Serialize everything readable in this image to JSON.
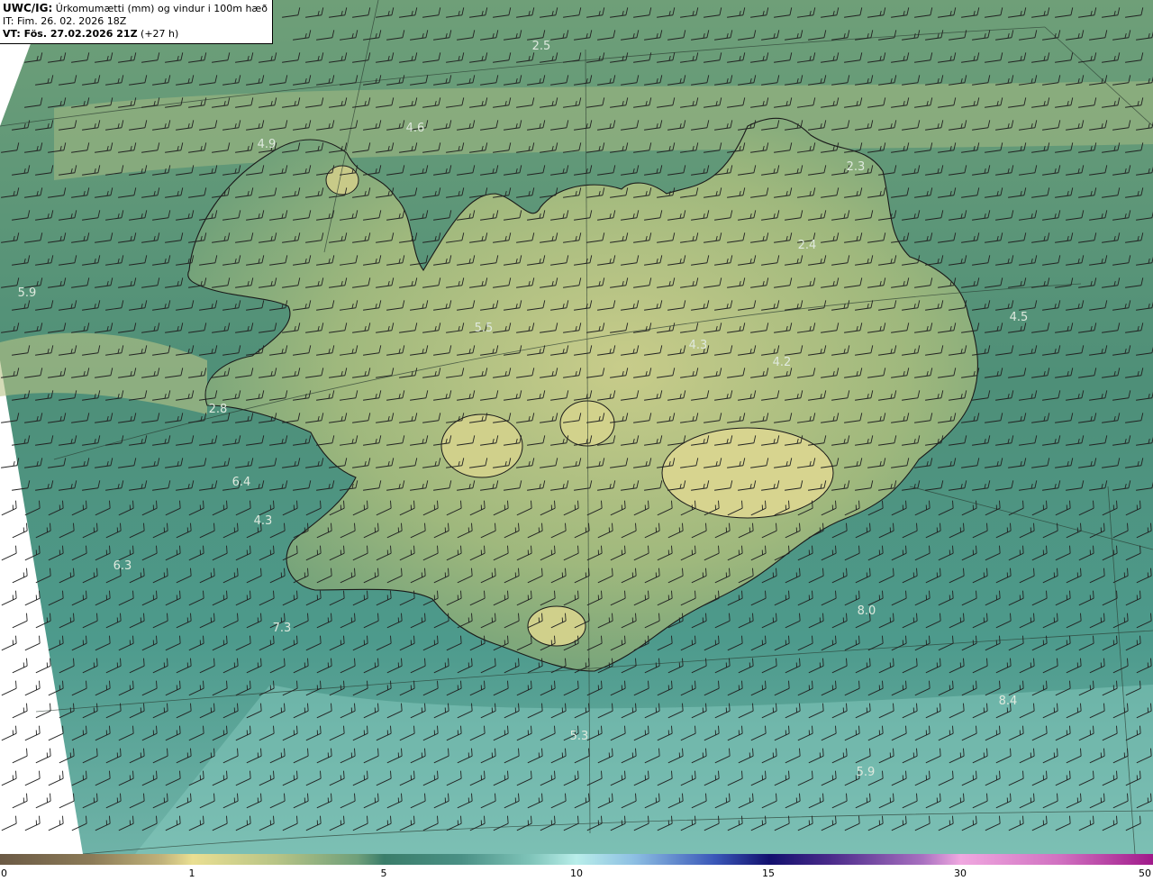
{
  "header": {
    "model_code": "UWC/IG:",
    "title": " Úrkomumætti (mm) og vindur i 100m hæð",
    "init_time": "IT: Fim. 26. 02. 2026 18Z",
    "valid_prefix": "VT: ",
    "valid_time": "Fös. 27.02.2026 21Z",
    "lead_time": " (+27 h)"
  },
  "colorbar": {
    "ticks": [
      "0",
      "1",
      "5",
      "10",
      "15",
      "30",
      "50"
    ],
    "colors": [
      "#6b5a45",
      "#eadf92",
      "#3a7d6a",
      "#b9eeea",
      "#12106e",
      "#f0a8e0",
      "#a01a8a"
    ]
  },
  "map": {
    "colors": {
      "ocean_north": "#5f9b76",
      "ocean_south": "#3f8d7d",
      "land": "#a9bc7f",
      "land_high": "#d4d28e",
      "coast": "#1a1a1a",
      "barb": "#222222",
      "value_label": "#dfe9de"
    },
    "labels": [
      {
        "text": "2.5"
      },
      {
        "text": "4.6"
      },
      {
        "text": "4.9"
      },
      {
        "text": "2.3"
      },
      {
        "text": "2.4"
      },
      {
        "text": "5.9"
      },
      {
        "text": "5.5"
      },
      {
        "text": "4.5"
      },
      {
        "text": "4.3"
      },
      {
        "text": "4.2"
      },
      {
        "text": "2.8"
      },
      {
        "text": "6.4"
      },
      {
        "text": "4.3"
      },
      {
        "text": "6.3"
      },
      {
        "text": "7.3"
      },
      {
        "text": "8.0"
      },
      {
        "text": "8.4"
      },
      {
        "text": "5.3"
      },
      {
        "text": "5.9"
      }
    ]
  }
}
